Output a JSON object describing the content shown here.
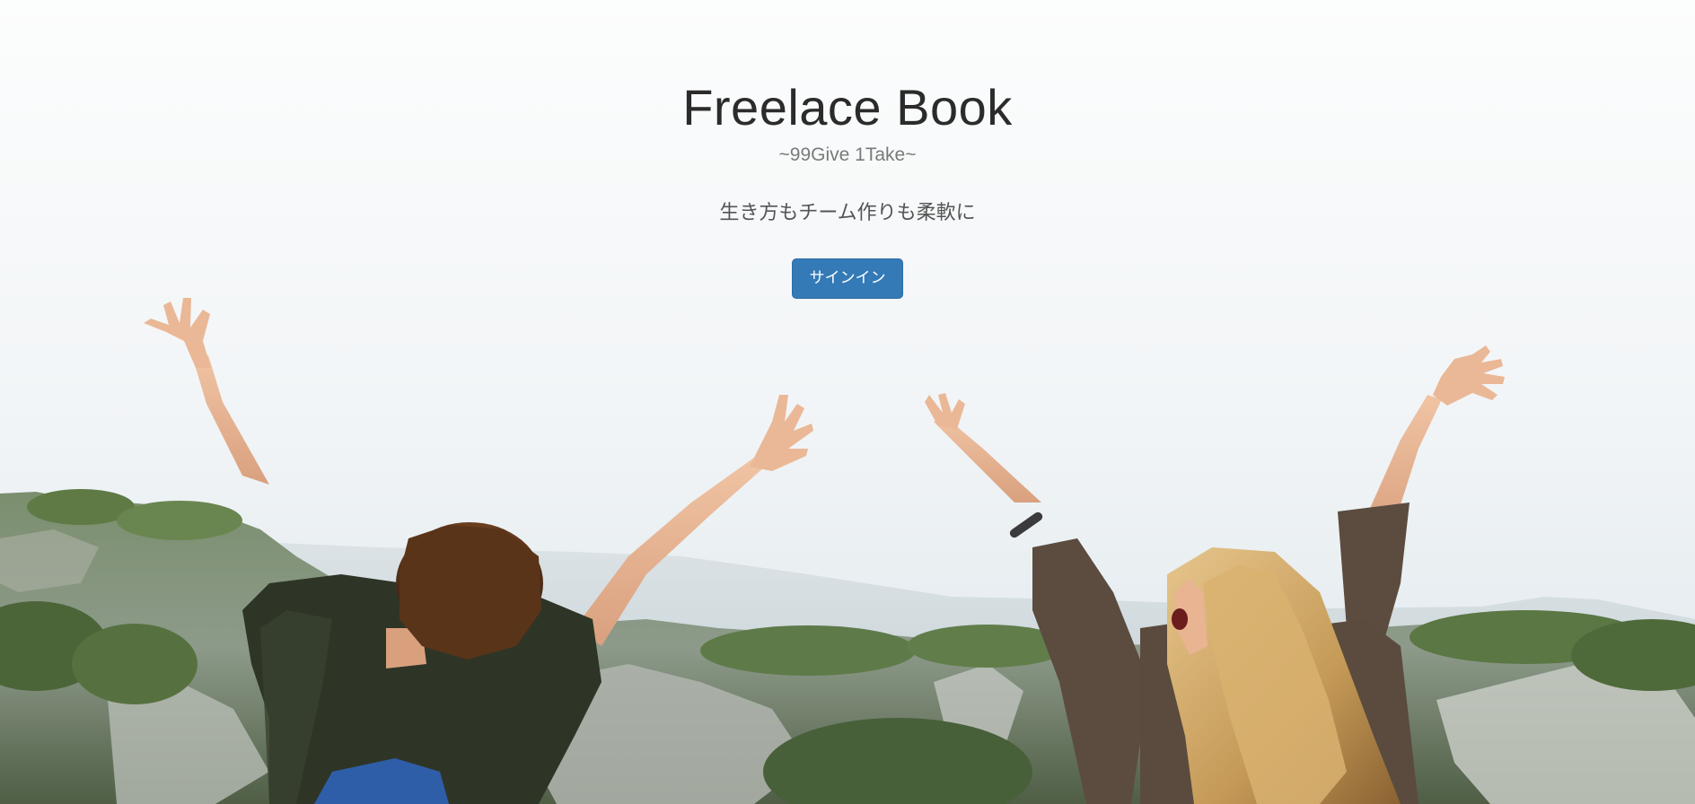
{
  "hero": {
    "title": "Freelace Book",
    "subtitle": "~99Give 1Take~",
    "tagline": "生き方もチーム作りも柔軟に",
    "signin_label": "サインイン"
  },
  "colors": {
    "button_bg": "#337ab7",
    "title_text": "#2b2b2b",
    "subtitle_text": "#7a7a7a",
    "tagline_text": "#555555"
  },
  "background_photo": {
    "icon": "two-women-raising-arms-photo"
  }
}
